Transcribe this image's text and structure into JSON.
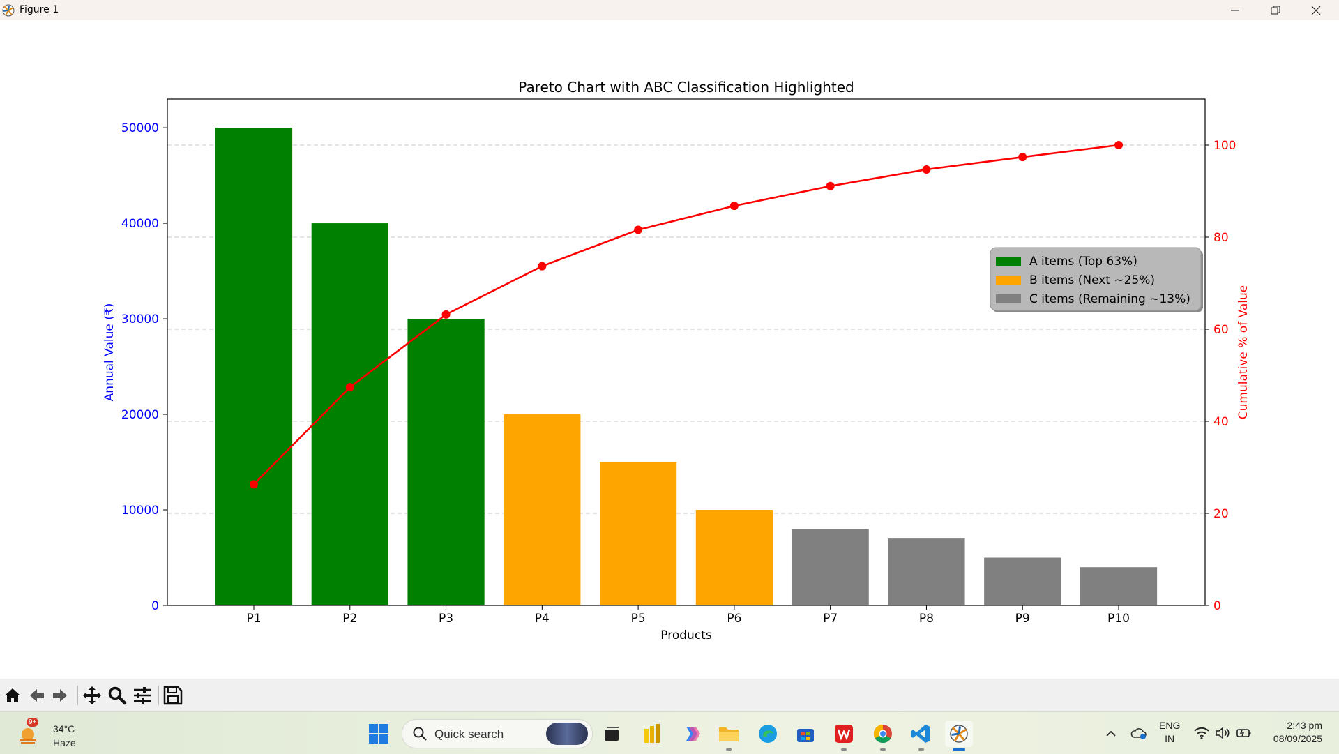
{
  "window": {
    "title": "Figure 1",
    "icons": [
      "matplotlib-icon",
      "minimize-icon",
      "restore-icon",
      "close-icon"
    ]
  },
  "chart_data": {
    "type": "bar",
    "title": "Pareto Chart with ABC Classification Highlighted",
    "xlabel": "Products",
    "ylabel": "Annual Value (₹)",
    "y2label": "Cumulative % of Value",
    "categories": [
      "P1",
      "P2",
      "P3",
      "P4",
      "P5",
      "P6",
      "P7",
      "P8",
      "P9",
      "P10"
    ],
    "values": [
      50000,
      40000,
      30000,
      20000,
      15000,
      10000,
      8000,
      7000,
      5000,
      4000
    ],
    "classes": [
      "A",
      "A",
      "A",
      "B",
      "B",
      "B",
      "C",
      "C",
      "C",
      "C"
    ],
    "cumulative_percent": [
      26.3,
      47.4,
      63.2,
      73.7,
      81.6,
      86.8,
      91.1,
      94.7,
      97.4,
      100.0
    ],
    "ylim": [
      0,
      53000
    ],
    "y2lim": [
      0,
      110
    ],
    "yticks": [
      0,
      10000,
      20000,
      30000,
      40000,
      50000
    ],
    "y2ticks": [
      0,
      20,
      40,
      60,
      80,
      100
    ],
    "grid": "horizontal dashed",
    "legend_position": "center-right",
    "legend": [
      {
        "label": "A items (Top 63%)",
        "class": "A"
      },
      {
        "label": "B items (Next ~25%)",
        "class": "B"
      },
      {
        "label": "C items (Remaining ~13%)",
        "class": "C"
      }
    ],
    "colors": {
      "A": "#008000",
      "B": "#ffa500",
      "C": "#808080",
      "line": "#ff0000",
      "left_axis": "#0000ff",
      "right_axis": "#ff0000"
    }
  },
  "toolbar": {
    "icons": [
      "home-icon",
      "back-icon",
      "forward-icon",
      "pan-icon",
      "zoom-icon",
      "configure-subplots-icon",
      "save-icon"
    ]
  },
  "taskbar": {
    "weather": {
      "badge": "9+",
      "temp": "34°C",
      "condition": "Haze"
    },
    "search_placeholder": "Quick search",
    "language": {
      "line1": "ENG",
      "line2": "IN"
    },
    "clock": {
      "time": "2:43 pm",
      "date": "08/09/2025"
    }
  }
}
